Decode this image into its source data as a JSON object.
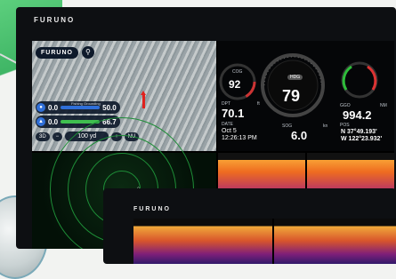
{
  "brand": "FURUNO",
  "chart": {
    "logo": "FURUNO",
    "waypoint1": {
      "value": "0.0",
      "hdr": "Fishing Grounding",
      "val2": "50.0"
    },
    "waypoint2": {
      "value": "0.0",
      "val2": "66.7"
    },
    "mode_3d": "3D",
    "range": "100 yd",
    "nu": "NU"
  },
  "instruments": {
    "cog_label": "COG",
    "cog_value": "92",
    "hdg_label": "HDG",
    "hdg_value": "79",
    "dpt_label": "DPT",
    "dpt_unit": "ft",
    "dpt_value": "70.1",
    "sog_label": "SOG",
    "sog_unit": "kn",
    "sog_value": "6.0",
    "date_label": "DATE",
    "date_value": "Oct 5",
    "time_value": "12:26:13 PM",
    "ggo_label": "GGO",
    "ggo_unit": "NM",
    "ggo_value": "994.2",
    "pos_label": "POS",
    "lat": "N 37°49.193'",
    "lon": "W 122°23.932'"
  },
  "monitor2": {
    "brand": "FURUNO"
  }
}
